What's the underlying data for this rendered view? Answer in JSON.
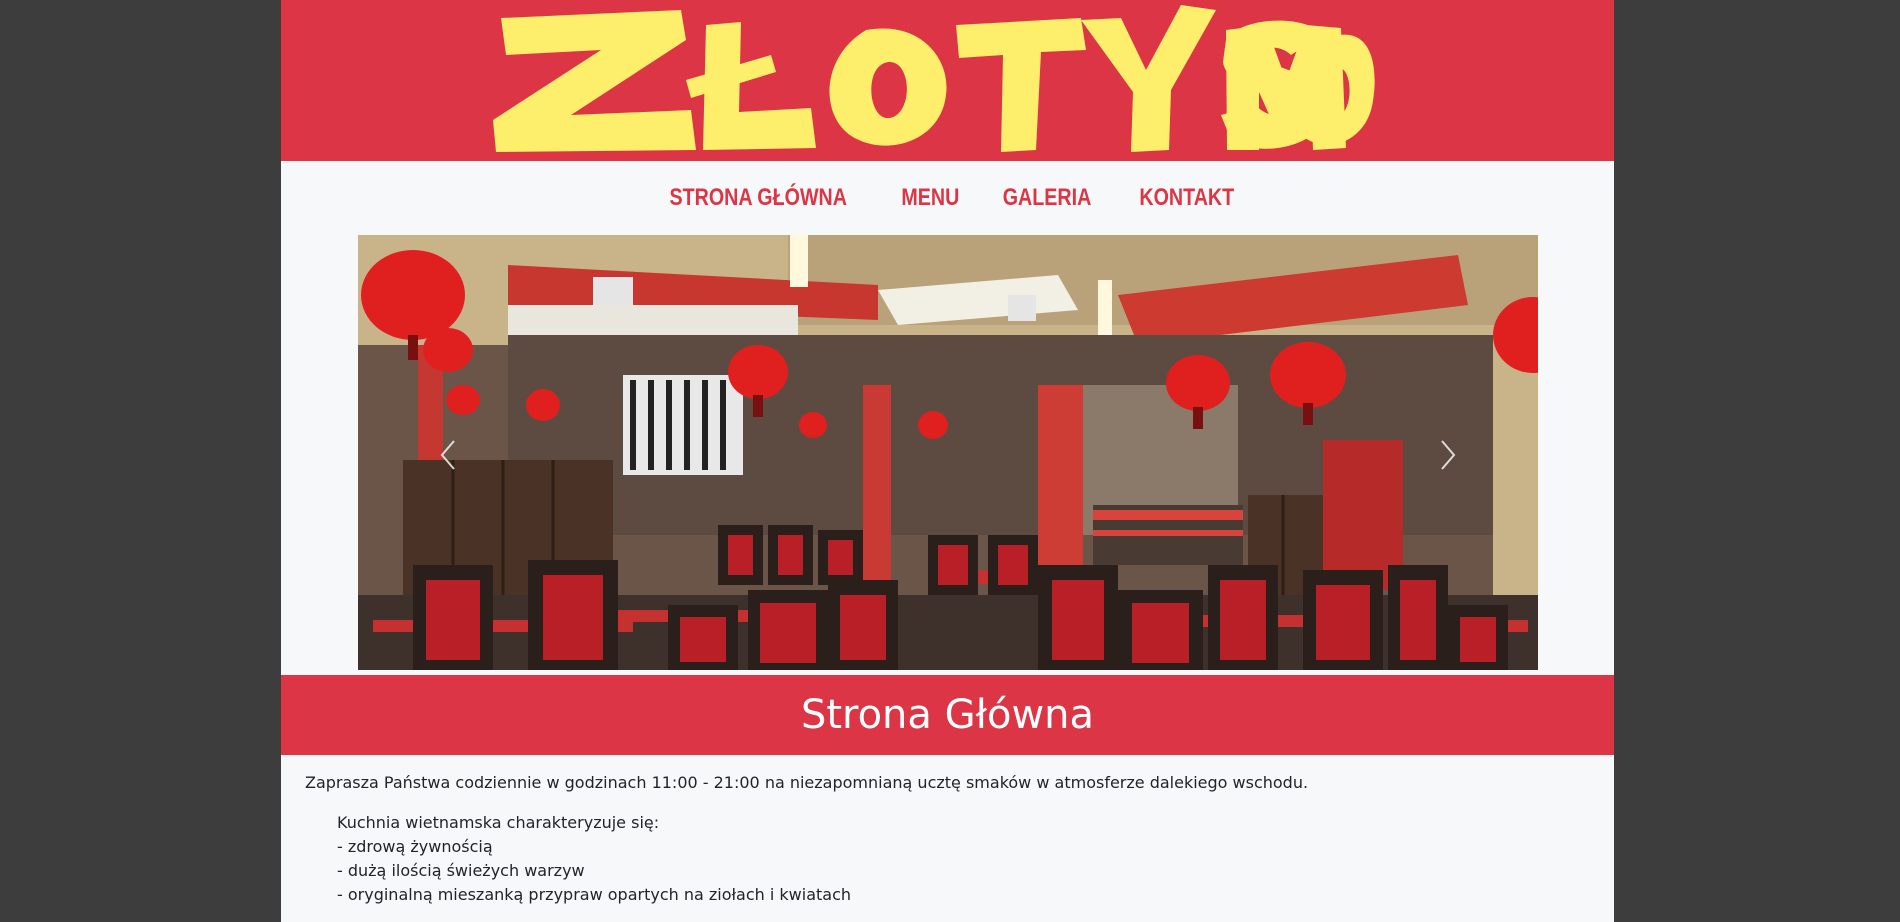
{
  "header": {
    "logo_text": "ZŁOTY SMOK",
    "background_color": "#dc3545",
    "logo_color": "#fdee6c"
  },
  "nav": {
    "items": [
      {
        "label": "STRONA GŁÓWNA"
      },
      {
        "label": "MENU"
      },
      {
        "label": "GALERIA"
      },
      {
        "label": "KONTAKT"
      }
    ]
  },
  "carousel": {
    "image_name": "restaurant-interior-photo",
    "prev_icon": "chevron-left-icon",
    "next_icon": "chevron-right-icon"
  },
  "main": {
    "title": "Strona Główna",
    "intro": "Zaprasza Państwa codziennie w godzinach 11:00 - 21:00 na niezapomnianą ucztę smaków w atmosferze dalekiego wschodu.",
    "features_heading": "Kuchnia wietnamska charakteryzuje się:",
    "features": [
      "- zdrową żywnością",
      "- dużą ilością świeżych warzyw",
      "- oryginalną mieszanką przypraw opartych na ziołach i kwiatach"
    ]
  },
  "colors": {
    "accent": "#dc3545",
    "page_background": "#f7f8fa",
    "outer_background": "#3d3d3d"
  }
}
